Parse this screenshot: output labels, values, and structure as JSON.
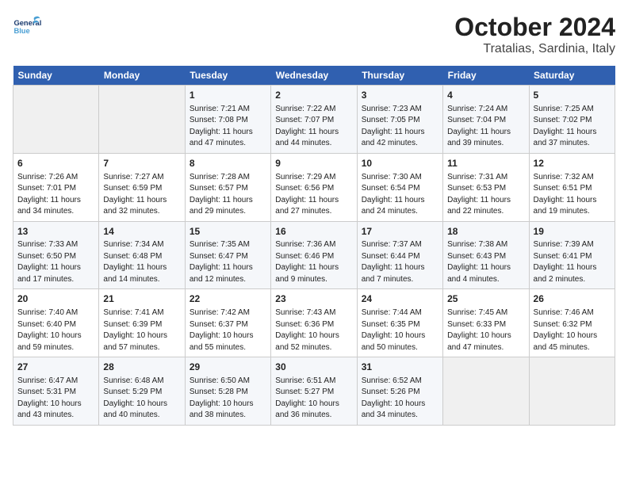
{
  "header": {
    "logo_general": "General",
    "logo_blue": "Blue",
    "title": "October 2024",
    "subtitle": "Tratalias, Sardinia, Italy"
  },
  "calendar": {
    "days_of_week": [
      "Sunday",
      "Monday",
      "Tuesday",
      "Wednesday",
      "Thursday",
      "Friday",
      "Saturday"
    ],
    "weeks": [
      [
        {
          "day": "",
          "info": ""
        },
        {
          "day": "",
          "info": ""
        },
        {
          "day": "1",
          "info": "Sunrise: 7:21 AM\nSunset: 7:08 PM\nDaylight: 11 hours and 47 minutes."
        },
        {
          "day": "2",
          "info": "Sunrise: 7:22 AM\nSunset: 7:07 PM\nDaylight: 11 hours and 44 minutes."
        },
        {
          "day": "3",
          "info": "Sunrise: 7:23 AM\nSunset: 7:05 PM\nDaylight: 11 hours and 42 minutes."
        },
        {
          "day": "4",
          "info": "Sunrise: 7:24 AM\nSunset: 7:04 PM\nDaylight: 11 hours and 39 minutes."
        },
        {
          "day": "5",
          "info": "Sunrise: 7:25 AM\nSunset: 7:02 PM\nDaylight: 11 hours and 37 minutes."
        }
      ],
      [
        {
          "day": "6",
          "info": "Sunrise: 7:26 AM\nSunset: 7:01 PM\nDaylight: 11 hours and 34 minutes."
        },
        {
          "day": "7",
          "info": "Sunrise: 7:27 AM\nSunset: 6:59 PM\nDaylight: 11 hours and 32 minutes."
        },
        {
          "day": "8",
          "info": "Sunrise: 7:28 AM\nSunset: 6:57 PM\nDaylight: 11 hours and 29 minutes."
        },
        {
          "day": "9",
          "info": "Sunrise: 7:29 AM\nSunset: 6:56 PM\nDaylight: 11 hours and 27 minutes."
        },
        {
          "day": "10",
          "info": "Sunrise: 7:30 AM\nSunset: 6:54 PM\nDaylight: 11 hours and 24 minutes."
        },
        {
          "day": "11",
          "info": "Sunrise: 7:31 AM\nSunset: 6:53 PM\nDaylight: 11 hours and 22 minutes."
        },
        {
          "day": "12",
          "info": "Sunrise: 7:32 AM\nSunset: 6:51 PM\nDaylight: 11 hours and 19 minutes."
        }
      ],
      [
        {
          "day": "13",
          "info": "Sunrise: 7:33 AM\nSunset: 6:50 PM\nDaylight: 11 hours and 17 minutes."
        },
        {
          "day": "14",
          "info": "Sunrise: 7:34 AM\nSunset: 6:48 PM\nDaylight: 11 hours and 14 minutes."
        },
        {
          "day": "15",
          "info": "Sunrise: 7:35 AM\nSunset: 6:47 PM\nDaylight: 11 hours and 12 minutes."
        },
        {
          "day": "16",
          "info": "Sunrise: 7:36 AM\nSunset: 6:46 PM\nDaylight: 11 hours and 9 minutes."
        },
        {
          "day": "17",
          "info": "Sunrise: 7:37 AM\nSunset: 6:44 PM\nDaylight: 11 hours and 7 minutes."
        },
        {
          "day": "18",
          "info": "Sunrise: 7:38 AM\nSunset: 6:43 PM\nDaylight: 11 hours and 4 minutes."
        },
        {
          "day": "19",
          "info": "Sunrise: 7:39 AM\nSunset: 6:41 PM\nDaylight: 11 hours and 2 minutes."
        }
      ],
      [
        {
          "day": "20",
          "info": "Sunrise: 7:40 AM\nSunset: 6:40 PM\nDaylight: 10 hours and 59 minutes."
        },
        {
          "day": "21",
          "info": "Sunrise: 7:41 AM\nSunset: 6:39 PM\nDaylight: 10 hours and 57 minutes."
        },
        {
          "day": "22",
          "info": "Sunrise: 7:42 AM\nSunset: 6:37 PM\nDaylight: 10 hours and 55 minutes."
        },
        {
          "day": "23",
          "info": "Sunrise: 7:43 AM\nSunset: 6:36 PM\nDaylight: 10 hours and 52 minutes."
        },
        {
          "day": "24",
          "info": "Sunrise: 7:44 AM\nSunset: 6:35 PM\nDaylight: 10 hours and 50 minutes."
        },
        {
          "day": "25",
          "info": "Sunrise: 7:45 AM\nSunset: 6:33 PM\nDaylight: 10 hours and 47 minutes."
        },
        {
          "day": "26",
          "info": "Sunrise: 7:46 AM\nSunset: 6:32 PM\nDaylight: 10 hours and 45 minutes."
        }
      ],
      [
        {
          "day": "27",
          "info": "Sunrise: 6:47 AM\nSunset: 5:31 PM\nDaylight: 10 hours and 43 minutes."
        },
        {
          "day": "28",
          "info": "Sunrise: 6:48 AM\nSunset: 5:29 PM\nDaylight: 10 hours and 40 minutes."
        },
        {
          "day": "29",
          "info": "Sunrise: 6:50 AM\nSunset: 5:28 PM\nDaylight: 10 hours and 38 minutes."
        },
        {
          "day": "30",
          "info": "Sunrise: 6:51 AM\nSunset: 5:27 PM\nDaylight: 10 hours and 36 minutes."
        },
        {
          "day": "31",
          "info": "Sunrise: 6:52 AM\nSunset: 5:26 PM\nDaylight: 10 hours and 34 minutes."
        },
        {
          "day": "",
          "info": ""
        },
        {
          "day": "",
          "info": ""
        }
      ]
    ]
  }
}
